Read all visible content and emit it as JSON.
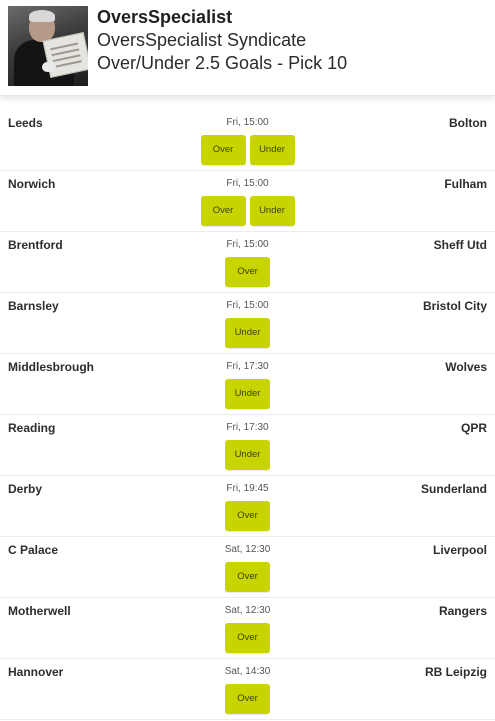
{
  "header": {
    "name": "OversSpecialist",
    "syndicate": "OversSpecialist Syndicate",
    "pick": "Over/Under 2.5 Goals - Pick 10"
  },
  "colors": {
    "accent": "#c8d400",
    "divider": "#ececec"
  },
  "matches": [
    {
      "home": "Leeds",
      "away": "Bolton",
      "time": "Fri, 15:00",
      "options": [
        "Over",
        "Under"
      ]
    },
    {
      "home": "Norwich",
      "away": "Fulham",
      "time": "Fri, 15:00",
      "options": [
        "Over",
        "Under"
      ]
    },
    {
      "home": "Brentford",
      "away": "Sheff Utd",
      "time": "Fri, 15:00",
      "options": [
        "Over"
      ]
    },
    {
      "home": "Barnsley",
      "away": "Bristol City",
      "time": "Fri, 15:00",
      "options": [
        "Under"
      ]
    },
    {
      "home": "Middlesbrough",
      "away": "Wolves",
      "time": "Fri, 17:30",
      "options": [
        "Under"
      ]
    },
    {
      "home": "Reading",
      "away": "QPR",
      "time": "Fri, 17:30",
      "options": [
        "Under"
      ]
    },
    {
      "home": "Derby",
      "away": "Sunderland",
      "time": "Fri, 19:45",
      "options": [
        "Over"
      ]
    },
    {
      "home": "C Palace",
      "away": "Liverpool",
      "time": "Sat, 12:30",
      "options": [
        "Over"
      ]
    },
    {
      "home": "Motherwell",
      "away": "Rangers",
      "time": "Sat, 12:30",
      "options": [
        "Over"
      ]
    },
    {
      "home": "Hannover",
      "away": "RB Leipzig",
      "time": "Sat, 14:30",
      "options": [
        "Over"
      ]
    }
  ]
}
